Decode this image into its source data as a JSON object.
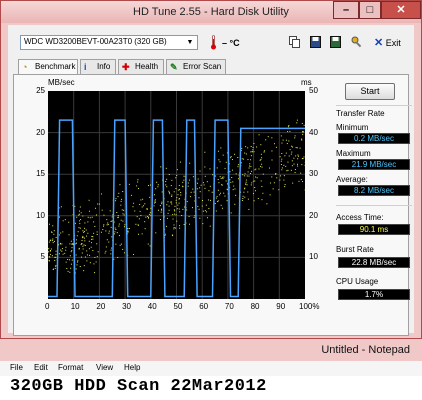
{
  "hdtune": {
    "title": "HD Tune 2.55 - Hard Disk Utility",
    "drive": "WDC WD3200BEVT-00A23T0 (320 GB)",
    "temperature": "– °C",
    "toolbar_icons": [
      "copy-icon",
      "save-icon",
      "save-screenshot-icon",
      "options-icon"
    ],
    "exit_label": "Exit",
    "tabs": [
      {
        "label": "Benchmark",
        "icon": "benchmark-icon",
        "active": true
      },
      {
        "label": "Info",
        "icon": "info-icon"
      },
      {
        "label": "Health",
        "icon": "health-icon"
      },
      {
        "label": "Error Scan",
        "icon": "error-scan-icon"
      }
    ],
    "start_label": "Start",
    "transfer_rate_label": "Transfer Rate",
    "minimum_label": "Minimum",
    "minimum_value": "0.2 MB/sec",
    "maximum_label": "Maximum",
    "maximum_value": "21.9 MB/sec",
    "average_label": "Average:",
    "average_value": "8.2 MB/sec",
    "access_time_label": "Access Time:",
    "access_time_value": "90.1 ms",
    "burst_rate_label": "Burst Rate",
    "burst_rate_value": "22.8 MB/sec",
    "cpu_usage_label": "CPU Usage",
    "cpu_usage_value": "1.7%",
    "colors": {
      "transfer_line": "#4aa3ff",
      "access_dots": "#e8e84a",
      "min_max_text": "#4ac8ff",
      "access_text": "#ffff40",
      "cpu_text": "#ffffff"
    }
  },
  "chart_data": {
    "type": "line",
    "ylabel_left": "MB/sec",
    "ylabel_right": "ms",
    "ylim_left": [
      0,
      25
    ],
    "ylim_right": [
      0,
      50
    ],
    "yticks_left": [
      "25",
      "20",
      "15",
      "10",
      "5"
    ],
    "yticks_right": [
      "50",
      "40",
      "30",
      "20",
      "10"
    ],
    "xticks": [
      "0",
      "10",
      "20",
      "30",
      "40",
      "50",
      "60",
      "70",
      "80",
      "90",
      "100%"
    ],
    "grid": true,
    "series": [
      {
        "name": "Transfer Rate",
        "axis": "left",
        "x": [
          0,
          3.5,
          4.5,
          9.5,
          10.5,
          25,
          26,
          30,
          31,
          40,
          41,
          44.5,
          45.5,
          53,
          54,
          57,
          58,
          64,
          65,
          70,
          71,
          74,
          75,
          100
        ],
        "values": [
          0.3,
          0.3,
          21.5,
          21.5,
          0.3,
          0.3,
          21.5,
          21.5,
          0.3,
          0.3,
          21.5,
          21.5,
          0.3,
          0.3,
          21.5,
          21.5,
          0.3,
          0.3,
          21.5,
          21.5,
          0.3,
          0.3,
          20.5,
          20.5
        ]
      }
    ],
    "access_time_scatter": {
      "axis": "right",
      "x_range": [
        0,
        100
      ],
      "ms_trend": [
        12,
        36
      ],
      "spread_ms": 10
    }
  },
  "notepad": {
    "title": "Untitled - Notepad",
    "menu": [
      "File",
      "Edit",
      "Format",
      "View",
      "Help"
    ],
    "content": "320GB HDD Scan 22Mar2012"
  }
}
